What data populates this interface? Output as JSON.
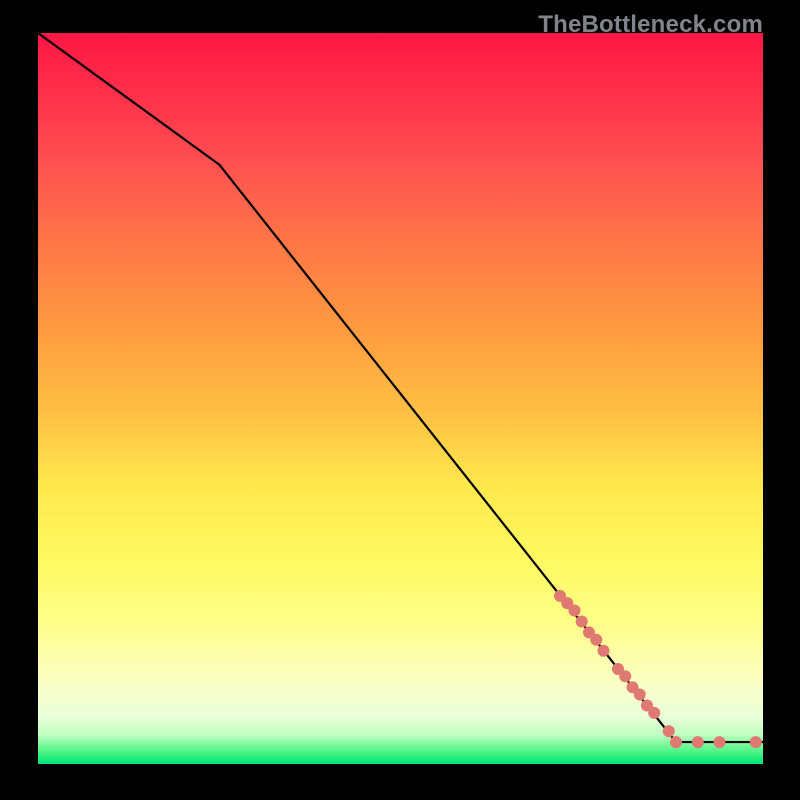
{
  "watermark": "TheBottleneck.com",
  "chart_data": {
    "type": "line",
    "title": "",
    "xlabel": "",
    "ylabel": "",
    "xlim": [
      0,
      100
    ],
    "ylim": [
      0,
      100
    ],
    "line": {
      "points": [
        {
          "x": 0,
          "y": 100
        },
        {
          "x": 25,
          "y": 82
        },
        {
          "x": 88,
          "y": 3
        },
        {
          "x": 100,
          "y": 3
        }
      ],
      "color": "#000000",
      "width": 2.2
    },
    "markers": {
      "color": "#e17973",
      "radius": 6,
      "points": [
        {
          "x": 72,
          "y": 23
        },
        {
          "x": 73,
          "y": 22
        },
        {
          "x": 74,
          "y": 21
        },
        {
          "x": 75,
          "y": 19.5
        },
        {
          "x": 76,
          "y": 18
        },
        {
          "x": 77,
          "y": 17
        },
        {
          "x": 78,
          "y": 15.5
        },
        {
          "x": 80,
          "y": 13
        },
        {
          "x": 81,
          "y": 12
        },
        {
          "x": 82,
          "y": 10.5
        },
        {
          "x": 83,
          "y": 9.5
        },
        {
          "x": 84,
          "y": 8
        },
        {
          "x": 85,
          "y": 7
        },
        {
          "x": 87,
          "y": 4.5
        },
        {
          "x": 88,
          "y": 3
        },
        {
          "x": 91,
          "y": 3
        },
        {
          "x": 94,
          "y": 3
        },
        {
          "x": 99,
          "y": 3
        }
      ]
    }
  }
}
